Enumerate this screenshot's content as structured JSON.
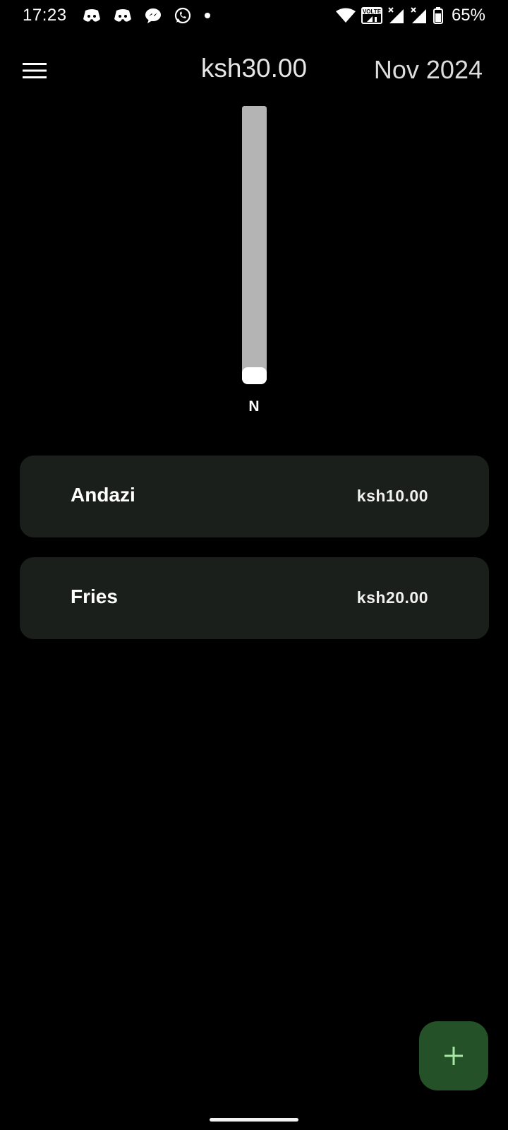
{
  "status_bar": {
    "time": "17:23",
    "left_icons": [
      "discord-icon",
      "discord-icon",
      "messenger-icon",
      "whatsapp-icon",
      "dot-icon"
    ],
    "volte_label": "VOLTE",
    "battery_percent": "65%"
  },
  "app_bar": {
    "menu_icon": "hamburger-menu-icon",
    "total": "ksh30.00",
    "month": "Nov 2024"
  },
  "chart_data": {
    "type": "bar",
    "categories": [
      "N"
    ],
    "values": [
      30
    ],
    "ylim": [
      0,
      30
    ],
    "bar_color": "#b4b4b4",
    "grid": false
  },
  "expenses": [
    {
      "name": "Andazi",
      "amount": "ksh10.00"
    },
    {
      "name": "Fries",
      "amount": "ksh20.00"
    }
  ],
  "fab": {
    "icon": "plus-icon"
  },
  "colors": {
    "background": "#000000",
    "card": "#1b1f1b",
    "fab": "#245128",
    "fab_icon": "#a8e6a3"
  }
}
